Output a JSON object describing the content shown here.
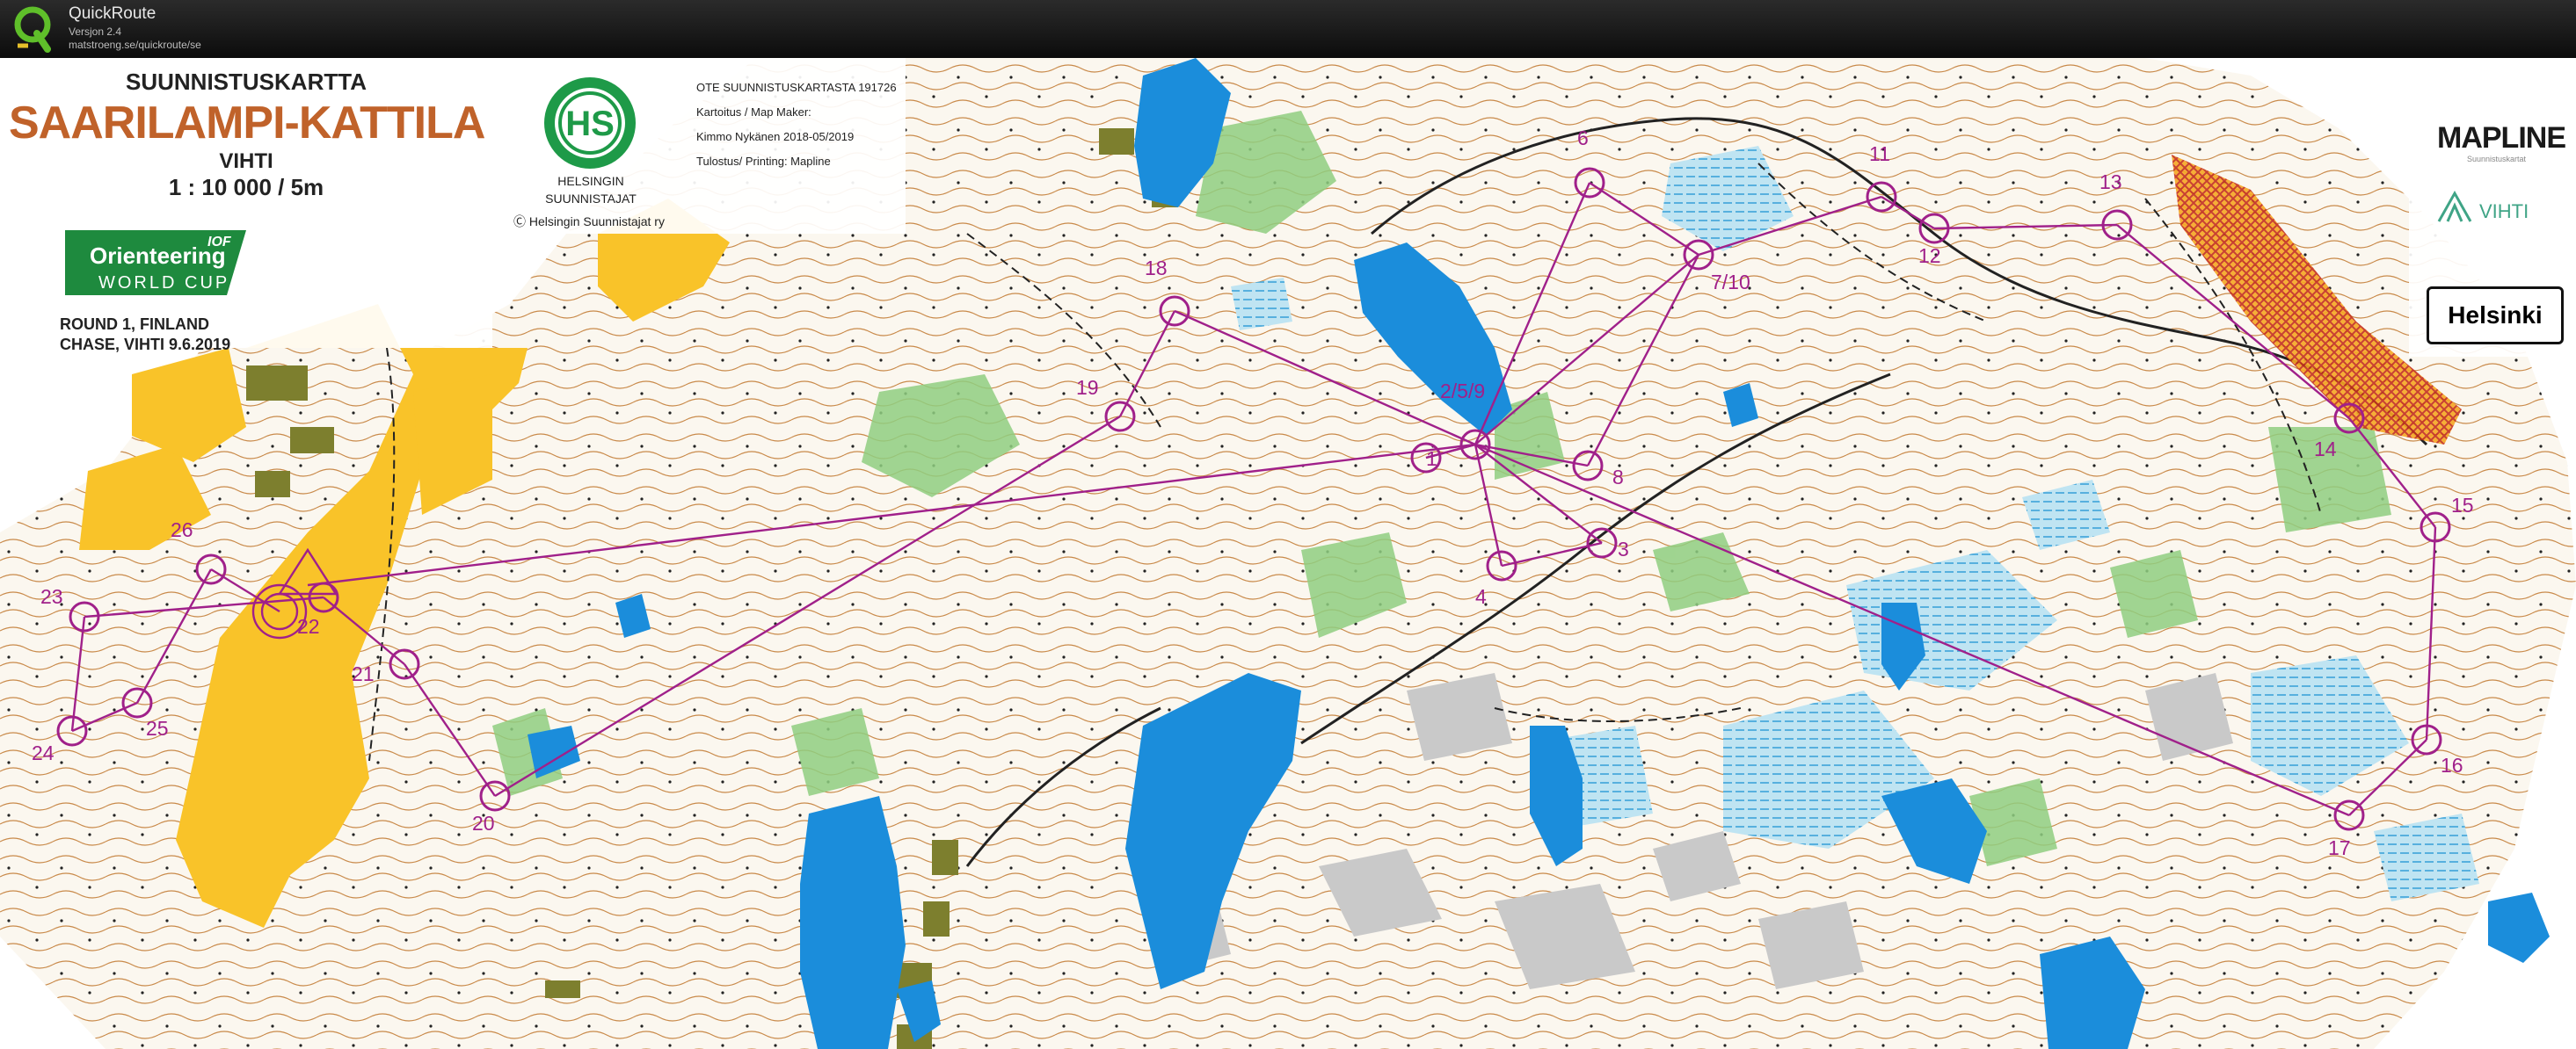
{
  "window": {
    "app_name": "QuickRoute",
    "version": "Versjon 2.4",
    "url": "matstroeng.se/quickroute/se"
  },
  "map": {
    "title_line1": "SUUNNISTUSKARTTA",
    "title_main": "SAARILAMPI-KATTILA",
    "location": "VIHTI",
    "scale": "1 : 10 000  /  5m",
    "event_line1": "ROUND 1, FINLAND",
    "event_line2": "CHASE, VIHTI 9.6.2019",
    "logo_wc_line1": "Orienteering",
    "logo_wc_line2": "WORLD CUP",
    "logo_wc_badge": "IOF",
    "club_logo_letters": "HS",
    "club_name_line1": "HELSINGIN",
    "club_name_line2": "SUUNNISTAJAT",
    "copyright": "Helsingin Suunnistajat ry",
    "info_line1": "OTE SUUNNISTUSKARTASTA 191726",
    "info_line2": "Kartoitus / Map Maker:",
    "info_line3": "Kimmo Nykänen 2018-05/2019",
    "info_line4": "Tulostus/ Printing: Mapline",
    "sponsor1": "MAPLINE",
    "sponsor1_sub": "Suunnistuskartat",
    "sponsor2": "VIHTI",
    "sponsor3": "Helsinki",
    "course_color": "#a0208a",
    "controls": [
      {
        "label": "1"
      },
      {
        "label": "2/5/9"
      },
      {
        "label": "3"
      },
      {
        "label": "4"
      },
      {
        "label": "6"
      },
      {
        "label": "7/10"
      },
      {
        "label": "8"
      },
      {
        "label": "11"
      },
      {
        "label": "12"
      },
      {
        "label": "13"
      },
      {
        "label": "14"
      },
      {
        "label": "15"
      },
      {
        "label": "16"
      },
      {
        "label": "17"
      },
      {
        "label": "18"
      },
      {
        "label": "19"
      },
      {
        "label": "20"
      },
      {
        "label": "21"
      },
      {
        "label": "22"
      },
      {
        "label": "23"
      },
      {
        "label": "24"
      },
      {
        "label": "25"
      },
      {
        "label": "26"
      }
    ]
  }
}
